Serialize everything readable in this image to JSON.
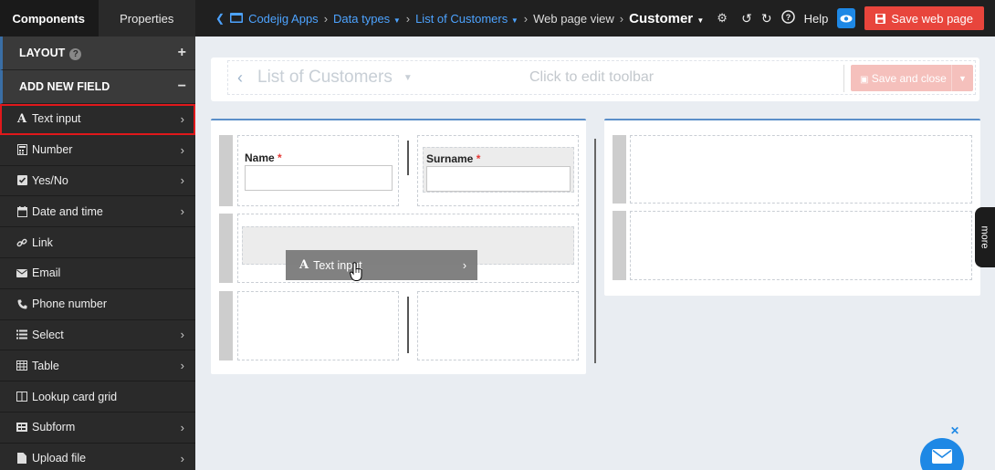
{
  "sidebar": {
    "tabs": [
      {
        "label": "Components",
        "active": true
      },
      {
        "label": "Properties",
        "active": false
      }
    ],
    "layout_section": {
      "label": "LAYOUT",
      "toggle": "+"
    },
    "add_field_section": {
      "label": "ADD NEW FIELD",
      "toggle": "−"
    },
    "items": [
      {
        "label": "Text input",
        "icon": "text-A-icon",
        "has_arrow": true
      },
      {
        "label": "Number",
        "icon": "calculator-icon",
        "has_arrow": true
      },
      {
        "label": "Yes/No",
        "icon": "checkbox-icon",
        "has_arrow": true
      },
      {
        "label": "Date and time",
        "icon": "calendar-icon",
        "has_arrow": true
      },
      {
        "label": "Link",
        "icon": "link-icon",
        "has_arrow": false
      },
      {
        "label": "Email",
        "icon": "envelope-icon",
        "has_arrow": false
      },
      {
        "label": "Phone number",
        "icon": "phone-icon",
        "has_arrow": false
      },
      {
        "label": "Select",
        "icon": "list-icon",
        "has_arrow": true
      },
      {
        "label": "Table",
        "icon": "table-icon",
        "has_arrow": true
      },
      {
        "label": "Lookup card grid",
        "icon": "columns-icon",
        "has_arrow": false
      },
      {
        "label": "Subform",
        "icon": "subform-icon",
        "has_arrow": true
      },
      {
        "label": "Upload file",
        "icon": "file-icon",
        "has_arrow": true
      }
    ],
    "highlighted_item": "Text input"
  },
  "topbar": {
    "breadcrumbs": [
      {
        "label": "Codejig Apps",
        "dropdown": false,
        "link": true
      },
      {
        "label": "Data types",
        "dropdown": true,
        "link": true
      },
      {
        "label": "List of Customers",
        "dropdown": true,
        "link": true
      },
      {
        "label": "Web page view",
        "dropdown": false,
        "link": false
      }
    ],
    "current": "Customer",
    "help_label": "Help",
    "save_label": "Save web page",
    "accent": "#1e88e5",
    "save_color": "#e8453c"
  },
  "toolbar": {
    "title": "List of Customers",
    "center_text": "Click to edit toolbar",
    "save_close_label": "Save and close"
  },
  "form": {
    "name_label": "Name",
    "surname_label": "Surname",
    "required_mark": "*"
  },
  "drag_ghost": {
    "label": "Text input"
  },
  "more_tab": {
    "label": "more"
  }
}
